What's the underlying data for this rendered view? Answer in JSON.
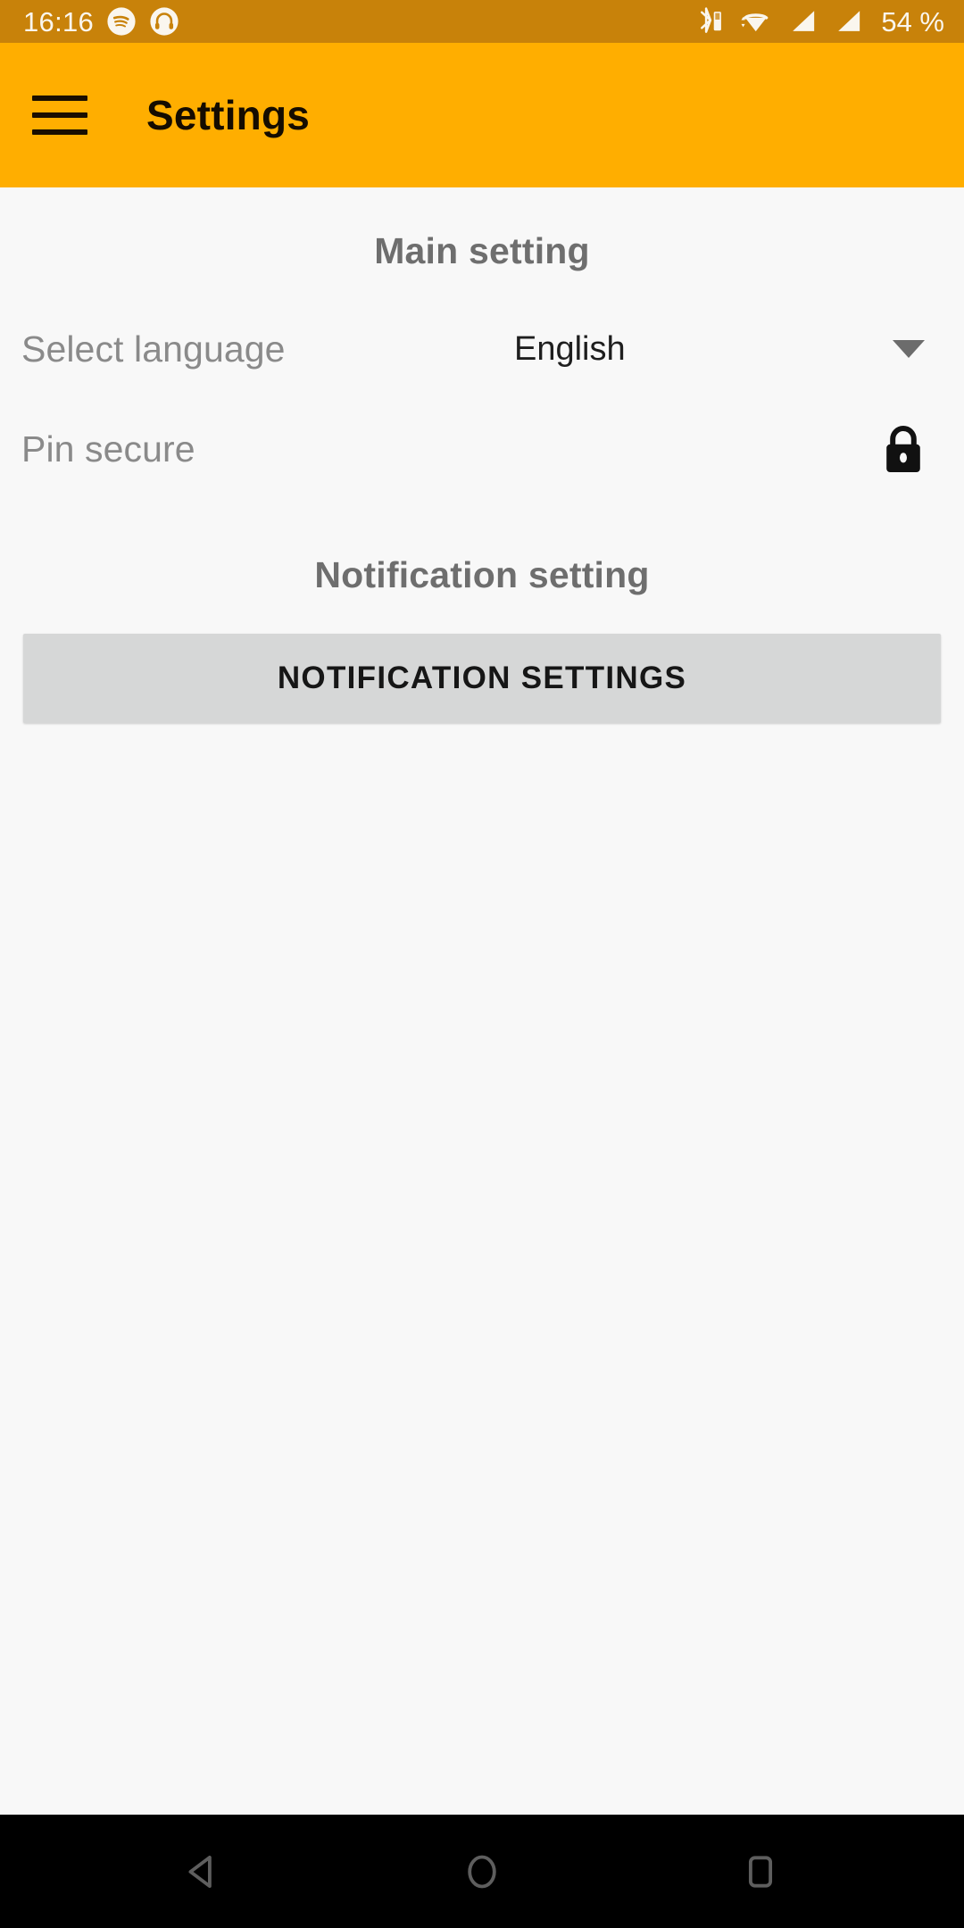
{
  "status_bar": {
    "time": "16:16",
    "battery_text": "54 %",
    "background_color": "#C8820A",
    "foreground_color": "#FAF6EE",
    "left_icons": [
      {
        "name": "spotify-icon",
        "label": "Spotify"
      },
      {
        "name": "headset-icon",
        "label": "Headset"
      }
    ],
    "right_icons": [
      {
        "name": "bluetooth-battery-icon",
        "label": "Bluetooth device battery"
      },
      {
        "name": "wifi-icon",
        "label": "Wi-Fi"
      },
      {
        "name": "signal-sim1-icon",
        "label": "Mobile signal SIM 1"
      },
      {
        "name": "signal-sim2-icon",
        "label": "Mobile signal SIM 2"
      }
    ]
  },
  "app_bar": {
    "title": "Settings",
    "menu_icon": "hamburger-menu-icon",
    "background_color": "#FFAE00",
    "title_color": "#150C00"
  },
  "main_section": {
    "heading": "Main setting",
    "rows": [
      {
        "label": "Select language",
        "value": "English",
        "control": "dropdown",
        "icon": "chevron-down-icon"
      },
      {
        "label": "Pin secure",
        "value": "",
        "control": "lock-toggle",
        "icon": "lock-closed-icon"
      }
    ]
  },
  "notification_section": {
    "heading": "Notification setting",
    "button_label": "NOTIFICATION SETTINGS",
    "button_color": "#D6D7D7"
  },
  "nav_bar": {
    "background_color": "#000000",
    "icon_color": "#5E5E5E",
    "buttons": [
      {
        "name": "nav-back-button",
        "label": "Back",
        "icon": "triangle-left-icon"
      },
      {
        "name": "nav-home-button",
        "label": "Home",
        "icon": "circle-icon"
      },
      {
        "name": "nav-recents-button",
        "label": "Recents",
        "icon": "square-icon"
      }
    ]
  }
}
